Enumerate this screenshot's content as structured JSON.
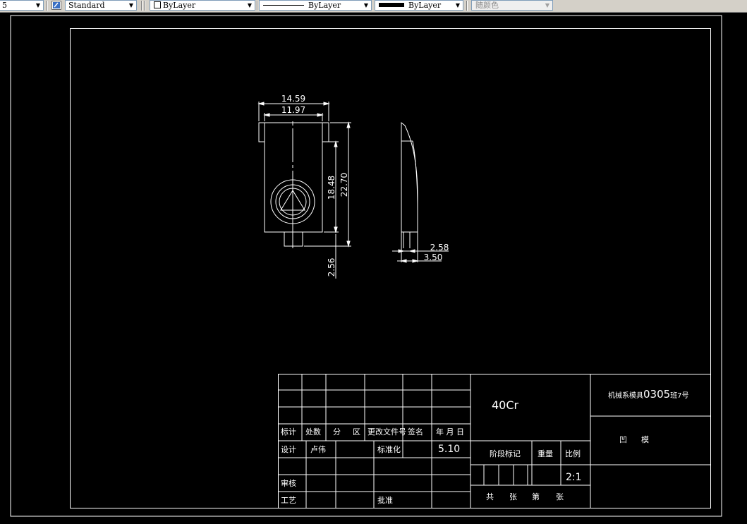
{
  "toolbar": {
    "first_combo_value": "5",
    "text_style": "Standard",
    "layer_color": "ByLayer",
    "linetype": "ByLayer",
    "lineweight": "ByLayer",
    "plot_style": "随颜色"
  },
  "drawing": {
    "dimensions": {
      "width_overall": "14.59",
      "width_inner": "11.97",
      "height_inner": "18.48",
      "height_overall": "22.70",
      "boss_height": "2.56",
      "side_step_small": "2.58",
      "side_step_large": "3.50"
    },
    "title_block": {
      "header_row": [
        "标计",
        "处数",
        "分",
        "区",
        "更改文件号",
        "签名",
        "年 月 日"
      ],
      "design_label": "设计",
      "designer": "卢伟",
      "standardization_label": "标准化",
      "date_value": "5.10",
      "review_label": "审核",
      "process_label": "工艺",
      "approve_label": "批准",
      "material": "40Cr",
      "stage_marks_label": "阶段标记",
      "weight_label": "重量",
      "scale_label": "比例",
      "scale_value": "2:1",
      "sheets_total_label": "共",
      "sheets_unit_1": "张",
      "sheet_no_label": "第",
      "sheets_unit_2": "张",
      "drawing_number_prefix": "机械系模具",
      "drawing_number": "0305",
      "drawing_number_suffix": "班7号",
      "part_name_1": "凹",
      "part_name_2": "模"
    }
  }
}
